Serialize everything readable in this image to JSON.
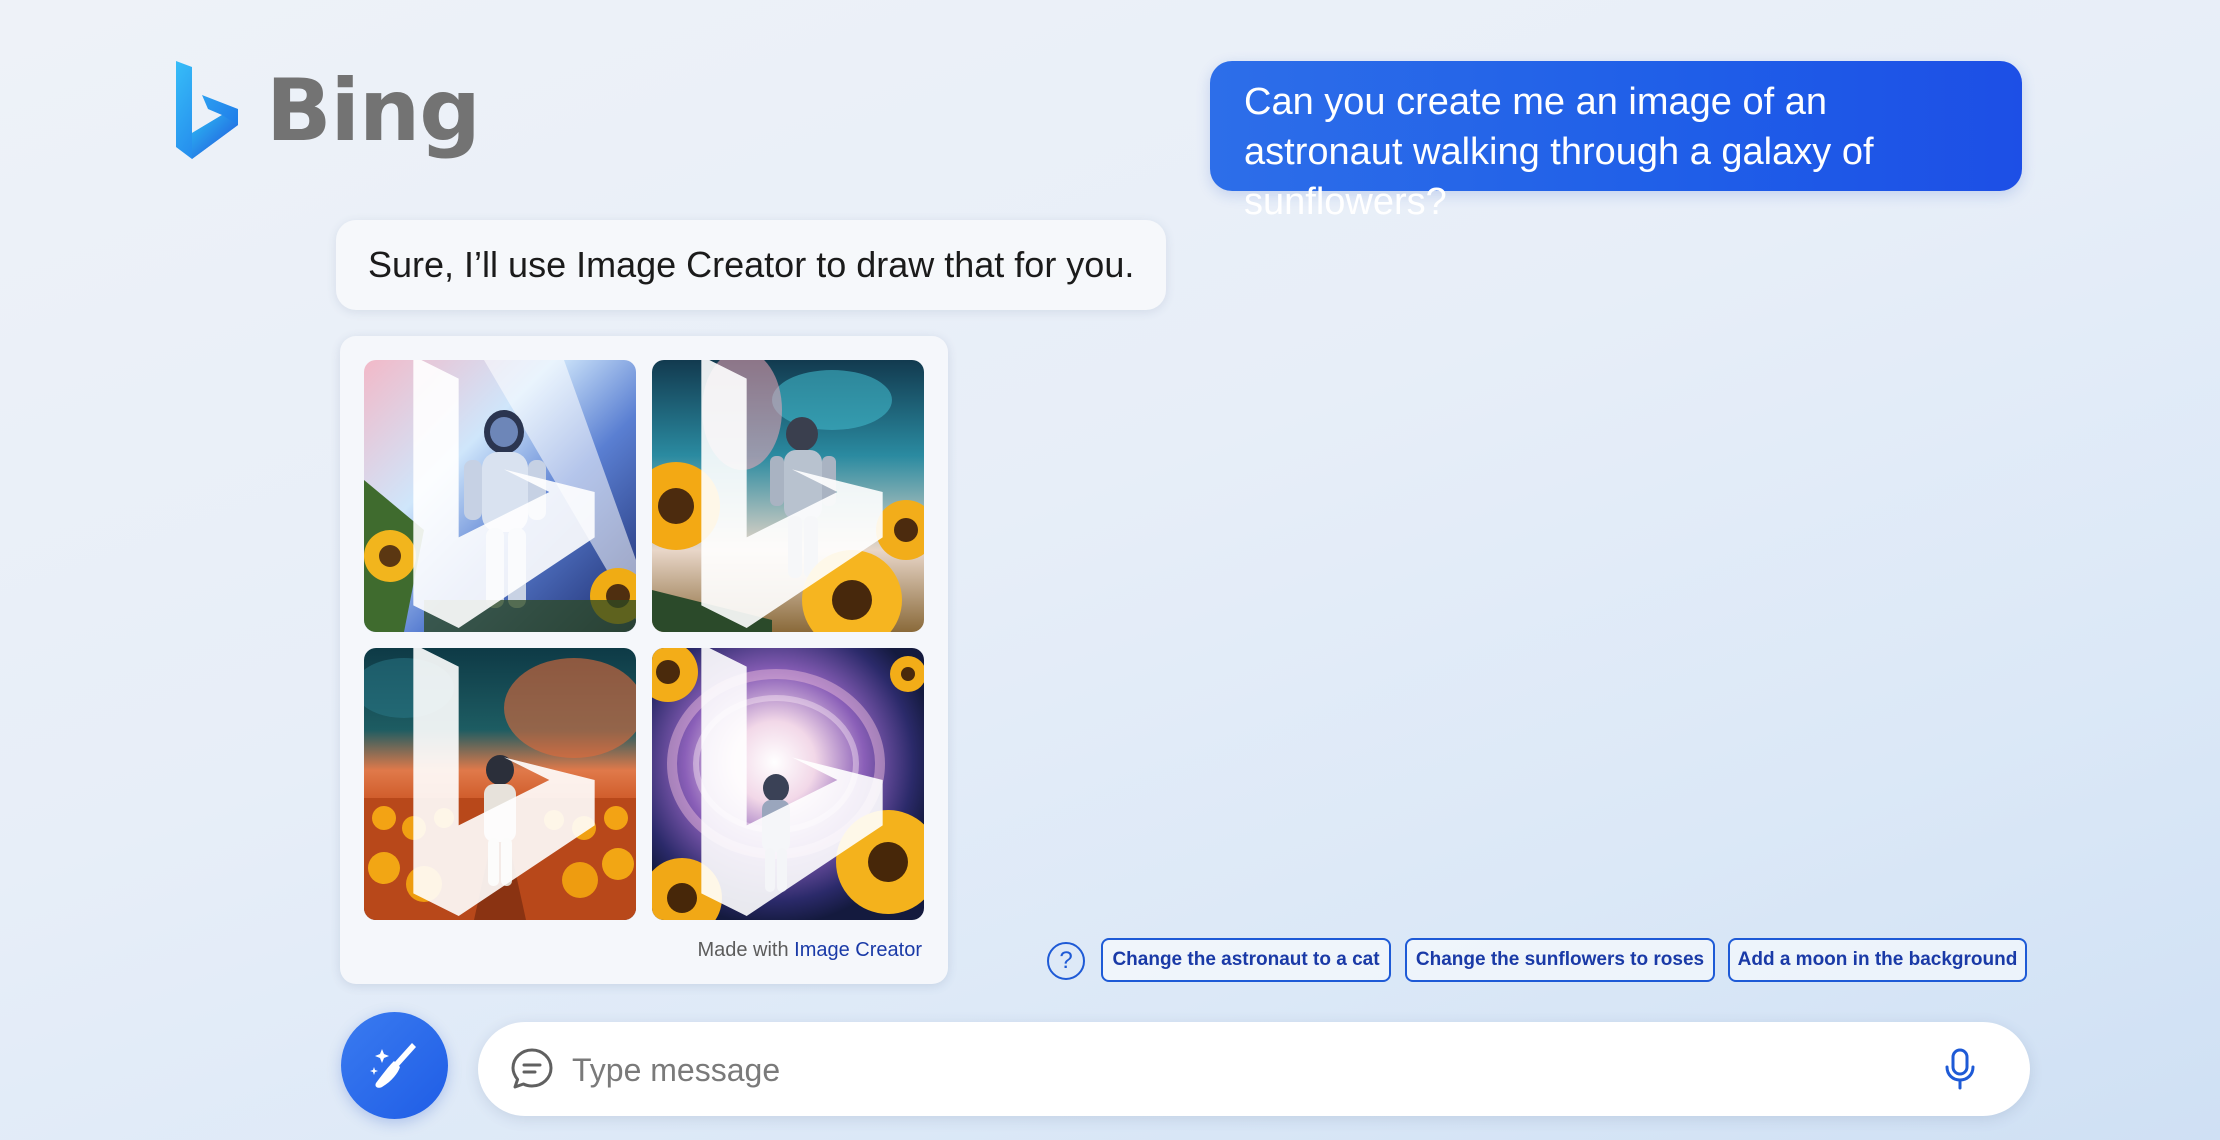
{
  "brand": {
    "name": "Bing",
    "accent": "#1f5ee8",
    "logo_icon": "bing-b-icon"
  },
  "conversation": {
    "user_message": "Can you create me an image of an astronaut walking through a galaxy of sunflowers?",
    "bot_reply": "Sure, I’ll use Image Creator to draw that for you."
  },
  "image_card": {
    "images": [
      {
        "icon": "generated-image"
      },
      {
        "icon": "generated-image"
      },
      {
        "icon": "generated-image"
      },
      {
        "icon": "generated-image"
      }
    ],
    "credit_prefix": "Made with",
    "credit_link": "Image Creator"
  },
  "suggestions": {
    "help_icon": "question-icon",
    "help_glyph": "?",
    "items": [
      "Change the astronaut to a cat",
      "Change the sunflowers to roses",
      "Add a moon in the background"
    ]
  },
  "composer": {
    "new_topic_icon": "broom-sparkle-icon",
    "chat_icon": "chat-bubble-icon",
    "placeholder": "Type message",
    "value": "",
    "mic_icon": "microphone-icon"
  }
}
